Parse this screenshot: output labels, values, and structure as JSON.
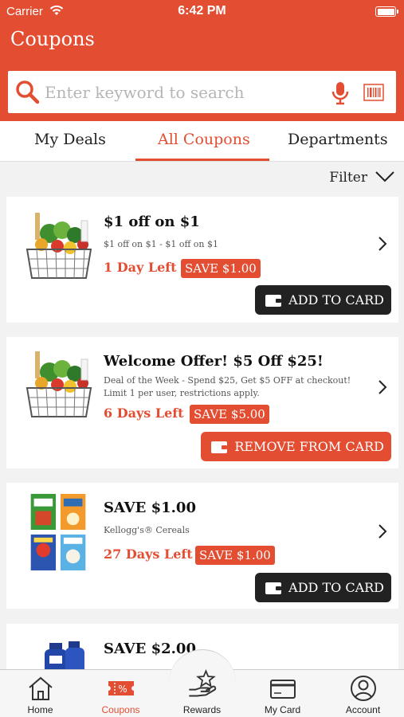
{
  "status": {
    "carrier": "Carrier",
    "time": "6:42 PM"
  },
  "header": {
    "title": "Coupons"
  },
  "search": {
    "placeholder": "Enter keyword to search"
  },
  "tabs": [
    "My Deals",
    "All Coupons",
    "Departments"
  ],
  "filter": {
    "label": "Filter"
  },
  "coupons": [
    {
      "title": "$1 off on $1",
      "desc": "$1 off on $1 - $1 off on $1",
      "days": "1 Day Left",
      "save": "SAVE $1.00",
      "button": "ADD TO CARD",
      "image": "grocery-basket"
    },
    {
      "title": "Welcome Offer! $5 Off $25!",
      "desc": "Deal of the Week - Spend $25, Get $5 OFF at checkout! Limit 1 per user, restrictions apply.",
      "days": "6 Days Left",
      "save": "SAVE $5.00",
      "button": "REMOVE FROM CARD",
      "image": "grocery-basket"
    },
    {
      "title": "SAVE $1.00",
      "desc": "Kellogg's® Cereals",
      "days": "27 Days Left",
      "save": "SAVE $1.00",
      "button": "ADD TO CARD",
      "image": "cereal-boxes"
    },
    {
      "title": "SAVE $2.00",
      "image": "cleaning-bottles"
    }
  ],
  "tabbar": [
    {
      "label": "Home",
      "icon": "home-icon"
    },
    {
      "label": "Coupons",
      "icon": "coupon-icon",
      "badge": "%"
    },
    {
      "label": "Rewards",
      "icon": "rewards-icon"
    },
    {
      "label": "My Card",
      "icon": "card-icon"
    },
    {
      "label": "Account",
      "icon": "account-icon"
    }
  ],
  "colors": {
    "brand": "#e34e33",
    "dark_button": "#222222"
  }
}
